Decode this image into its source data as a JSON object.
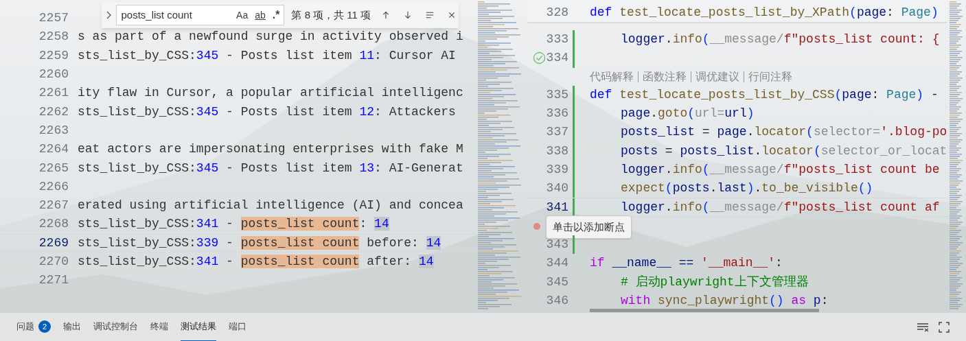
{
  "left_editor": {
    "lines": [
      {
        "number": "2257",
        "current": false
      },
      {
        "number": "2258",
        "current": false,
        "segments": [
          {
            "text": "s as part of a newfound surge in activity observed i",
            "kind": "plain"
          }
        ]
      },
      {
        "number": "2259",
        "current": false,
        "segments": [
          {
            "text": "sts_list_by_CSS:",
            "kind": "plain"
          },
          {
            "text": "345",
            "kind": "num"
          },
          {
            "text": " - Posts list item ",
            "kind": "plain"
          },
          {
            "text": "11",
            "kind": "num"
          },
          {
            "text": ": Cursor AI",
            "kind": "plain"
          }
        ]
      },
      {
        "number": "2260",
        "current": false
      },
      {
        "number": "2261",
        "current": false,
        "segments": [
          {
            "text": "ity flaw in Cursor, a popular artificial intelligenc",
            "kind": "plain"
          }
        ]
      },
      {
        "number": "2262",
        "current": false,
        "segments": [
          {
            "text": "sts_list_by_CSS:",
            "kind": "plain"
          },
          {
            "text": "345",
            "kind": "num"
          },
          {
            "text": " - Posts list item ",
            "kind": "plain"
          },
          {
            "text": "12",
            "kind": "num"
          },
          {
            "text": ": Attackers",
            "kind": "plain"
          }
        ]
      },
      {
        "number": "2263",
        "current": false
      },
      {
        "number": "2264",
        "current": false,
        "segments": [
          {
            "text": "eat actors are impersonating enterprises with fake M",
            "kind": "plain"
          }
        ]
      },
      {
        "number": "2265",
        "current": false,
        "segments": [
          {
            "text": "sts_list_by_CSS:",
            "kind": "plain"
          },
          {
            "text": "345",
            "kind": "num"
          },
          {
            "text": " - Posts list item ",
            "kind": "plain"
          },
          {
            "text": "13",
            "kind": "num"
          },
          {
            "text": ": AI-Generat",
            "kind": "plain"
          }
        ]
      },
      {
        "number": "2266",
        "current": false
      },
      {
        "number": "2267",
        "current": false,
        "segments": [
          {
            "text": "erated using artificial intelligence (AI) and concea",
            "kind": "plain"
          }
        ]
      },
      {
        "number": "2268",
        "current": false,
        "segments": [
          {
            "text": "sts_list_by_CSS:",
            "kind": "plain"
          },
          {
            "text": "341",
            "kind": "num"
          },
          {
            "text": " - ",
            "kind": "plain"
          },
          {
            "text": "posts_list count",
            "kind": "match"
          },
          {
            "text": ": ",
            "kind": "plain"
          },
          {
            "text": "14",
            "kind": "num-hl"
          }
        ]
      },
      {
        "number": "2269",
        "current": true,
        "segments": [
          {
            "text": "sts_list_by_CSS:",
            "kind": "plain"
          },
          {
            "text": "339",
            "kind": "num"
          },
          {
            "text": " - ",
            "kind": "plain"
          },
          {
            "text": "posts_list count",
            "kind": "match"
          },
          {
            "text": " before: ",
            "kind": "plain"
          },
          {
            "text": "14",
            "kind": "num-hl"
          }
        ]
      },
      {
        "number": "2270",
        "current": false,
        "segments": [
          {
            "text": "sts_list_by_CSS:",
            "kind": "plain"
          },
          {
            "text": "341",
            "kind": "num"
          },
          {
            "text": " - ",
            "kind": "plain"
          },
          {
            "text": "posts_list count",
            "kind": "match"
          },
          {
            "text": " after: ",
            "kind": "plain"
          },
          {
            "text": "14",
            "kind": "num-hl"
          }
        ]
      },
      {
        "number": "2271",
        "current": false
      }
    ],
    "find_widget": {
      "value": "posts_list count",
      "options": [
        {
          "label": "Aa",
          "kind": "case",
          "selected": false
        },
        {
          "label": "ab",
          "kind": "word",
          "selected": false
        },
        {
          "label": ".*",
          "kind": "regex",
          "selected": false
        }
      ],
      "match_count": "第 8 项，共 11 项"
    }
  },
  "right_editor": {
    "sticky_line": {
      "number": "328",
      "segments": [
        {
          "text": "def",
          "kind": "keyword"
        },
        {
          "text": " test_locate_posts_list_by_XPath",
          "kind": "function"
        },
        {
          "text": "(",
          "kind": "paren"
        },
        {
          "text": "page",
          "kind": "param"
        },
        {
          "text": ": ",
          "kind": "plain"
        },
        {
          "text": "Page",
          "kind": "type"
        },
        {
          "text": ")",
          "kind": "paren"
        }
      ],
      "children": [
        {
          "kind": "code",
          "number": "333",
          "modified": true,
          "current": false,
          "segments": [
            {
              "text": "logger",
              "kind": "param"
            },
            {
              "text": ".",
              "kind": "plain"
            },
            {
              "text": "info",
              "kind": "function"
            },
            {
              "text": "(",
              "kind": "paren"
            },
            {
              "text": "__message/",
              "kind": "hint"
            },
            {
              "text": "f\"posts_list count: {",
              "kind": "string"
            }
          ]
        }
      ]
    },
    "lines": [
      {
        "kind": "code",
        "number": "334",
        "modified": true,
        "current": false,
        "passed": true
      },
      {
        "kind": "codelens",
        "links": [
          "代码解释",
          "函数注释",
          "调优建议",
          "行间注释"
        ]
      },
      {
        "kind": "code",
        "number": "335",
        "modified": true,
        "current": false,
        "segments": [
          {
            "text": "def",
            "kind": "keyword"
          },
          {
            "text": " test_locate_posts_list_by_CSS",
            "kind": "function"
          },
          {
            "text": "(",
            "kind": "paren"
          },
          {
            "text": "page",
            "kind": "param"
          },
          {
            "text": ": ",
            "kind": "plain"
          },
          {
            "text": "Page",
            "kind": "type"
          },
          {
            "text": ")",
            "kind": "paren"
          },
          {
            "text": " -",
            "kind": "plain"
          }
        ],
        "children": [
          {
            "kind": "code",
            "number": "336",
            "modified": true,
            "current": false,
            "segments": [
              {
                "text": "page",
                "kind": "param"
              },
              {
                "text": ".",
                "kind": "plain"
              },
              {
                "text": "goto",
                "kind": "function"
              },
              {
                "text": "(",
                "kind": "paren"
              },
              {
                "text": "url=",
                "kind": "hint"
              },
              {
                "text": "url",
                "kind": "param"
              },
              {
                "text": ")",
                "kind": "paren"
              }
            ]
          },
          {
            "kind": "code",
            "number": "337",
            "modified": true,
            "current": false,
            "segments": [
              {
                "text": "posts_list",
                "kind": "param"
              },
              {
                "text": " = ",
                "kind": "plain"
              },
              {
                "text": "page",
                "kind": "param"
              },
              {
                "text": ".",
                "kind": "plain"
              },
              {
                "text": "locator",
                "kind": "function"
              },
              {
                "text": "(",
                "kind": "paren"
              },
              {
                "text": "selector=",
                "kind": "hint"
              },
              {
                "text": "'.blog-po",
                "kind": "string"
              }
            ]
          },
          {
            "kind": "code",
            "number": "338",
            "modified": true,
            "current": false,
            "segments": [
              {
                "text": "posts",
                "kind": "param"
              },
              {
                "text": " = ",
                "kind": "plain"
              },
              {
                "text": "posts_list",
                "kind": "param"
              },
              {
                "text": ".",
                "kind": "plain"
              },
              {
                "text": "locator",
                "kind": "function"
              },
              {
                "text": "(",
                "kind": "paren"
              },
              {
                "text": "selector_or_locat",
                "kind": "hint"
              }
            ]
          },
          {
            "kind": "code",
            "number": "339",
            "modified": true,
            "current": false,
            "segments": [
              {
                "text": "logger",
                "kind": "param"
              },
              {
                "text": ".",
                "kind": "plain"
              },
              {
                "text": "info",
                "kind": "function"
              },
              {
                "text": "(",
                "kind": "paren"
              },
              {
                "text": "__message/",
                "kind": "hint"
              },
              {
                "text": "f\"posts_list count be",
                "kind": "string"
              }
            ]
          },
          {
            "kind": "code",
            "number": "340",
            "modified": true,
            "current": false,
            "segments": [
              {
                "text": "expect",
                "kind": "function"
              },
              {
                "text": "(",
                "kind": "paren"
              },
              {
                "text": "posts",
                "kind": "param"
              },
              {
                "text": ".",
                "kind": "plain"
              },
              {
                "text": "last",
                "kind": "param"
              },
              {
                "text": ")",
                "kind": "paren"
              },
              {
                "text": ".",
                "kind": "plain"
              },
              {
                "text": "to_be_visible",
                "kind": "function"
              },
              {
                "text": "()",
                "kind": "paren"
              }
            ]
          },
          {
            "kind": "code",
            "number": "341",
            "modified": true,
            "current": true,
            "segments": [
              {
                "text": "logger",
                "kind": "param"
              },
              {
                "text": ".",
                "kind": "plain"
              },
              {
                "text": "info",
                "kind": "function"
              },
              {
                "text": "(",
                "kind": "paren"
              },
              {
                "text": "__message/",
                "kind": "hint"
              },
              {
                "text": "f\"posts_list count af",
                "kind": "string"
              }
            ]
          }
        ]
      },
      {
        "kind": "code",
        "modified": true,
        "current": false,
        "tooltip": "单击以添加断点"
      },
      {
        "kind": "code",
        "number": "343",
        "modified": true,
        "current": false
      },
      {
        "kind": "code",
        "number": "344",
        "modified": false,
        "current": false,
        "segments": [
          {
            "text": "if",
            "kind": "control"
          },
          {
            "text": " __name__ == ",
            "kind": "param"
          },
          {
            "text": "'__main__'",
            "kind": "string"
          },
          {
            "text": ":",
            "kind": "plain"
          }
        ],
        "children": [
          {
            "kind": "code",
            "number": "345",
            "modified": false,
            "current": false,
            "segments": [
              {
                "text": "# 启动playwright上下文管理器",
                "kind": "comment"
              }
            ]
          },
          {
            "kind": "code",
            "number": "346",
            "modified": false,
            "current": false,
            "segments": [
              {
                "text": "with",
                "kind": "control"
              },
              {
                "text": " sync_playwright",
                "kind": "function"
              },
              {
                "text": "()",
                "kind": "paren"
              },
              {
                "text": " as",
                "kind": "control"
              },
              {
                "text": " p",
                "kind": "param"
              },
              {
                "text": ":",
                "kind": "plain"
              }
            ]
          }
        ]
      }
    ]
  },
  "panel": {
    "tabs": [
      {
        "label": "问题",
        "badge": "2",
        "selected": false
      },
      {
        "label": "输出",
        "selected": false
      },
      {
        "label": "调试控制台",
        "selected": false
      },
      {
        "label": "终端",
        "selected": false
      },
      {
        "label": "测试结果",
        "selected": true
      },
      {
        "label": "端口",
        "selected": false
      }
    ]
  }
}
